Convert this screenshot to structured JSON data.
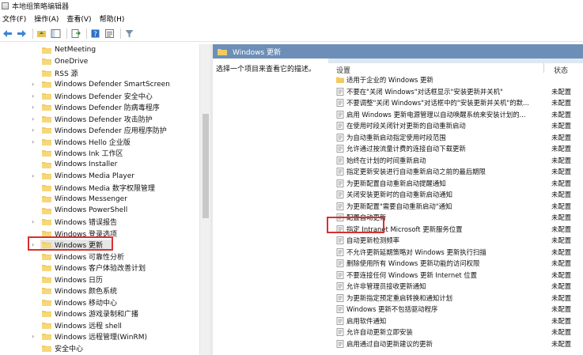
{
  "window": {
    "title": "本地组策略编辑器"
  },
  "menu": [
    "文件(F)",
    "操作(A)",
    "查看(V)",
    "帮助(H)"
  ],
  "toolbar": [
    "back-icon",
    "forward-icon",
    "up-folder-icon",
    "show-hide-tree-icon",
    "export-list-icon",
    "help-icon",
    "properties-icon",
    "filter-icon"
  ],
  "tree": {
    "items": [
      {
        "label": "NetMeeting",
        "expandable": false
      },
      {
        "label": "OneDrive",
        "expandable": false
      },
      {
        "label": "RSS 源",
        "expandable": false
      },
      {
        "label": "Windows Defender SmartScreen",
        "expandable": true
      },
      {
        "label": "Windows Defender 安全中心",
        "expandable": true
      },
      {
        "label": "Windows Defender 防病毒程序",
        "expandable": true
      },
      {
        "label": "Windows Defender 攻击防护",
        "expandable": true
      },
      {
        "label": "Windows Defender 应用程序防护",
        "expandable": true
      },
      {
        "label": "Windows Hello 企业版",
        "expandable": true
      },
      {
        "label": "Windows Ink 工作区",
        "expandable": false
      },
      {
        "label": "Windows Installer",
        "expandable": false
      },
      {
        "label": "Windows Media Player",
        "expandable": true
      },
      {
        "label": "Windows Media 数字权限管理",
        "expandable": false
      },
      {
        "label": "Windows Messenger",
        "expandable": false
      },
      {
        "label": "Windows PowerShell",
        "expandable": false
      },
      {
        "label": "Windows 错误报告",
        "expandable": true
      },
      {
        "label": "Windows 登录选项",
        "expandable": false
      },
      {
        "label": "Windows 更新",
        "expandable": true,
        "selected": true
      },
      {
        "label": "Windows 可靠性分析",
        "expandable": false
      },
      {
        "label": "Windows 客户体验改善计划",
        "expandable": false
      },
      {
        "label": "Windows 日历",
        "expandable": false
      },
      {
        "label": "Windows 颜色系统",
        "expandable": false
      },
      {
        "label": "Windows 移动中心",
        "expandable": false
      },
      {
        "label": "Windows 游戏录制和广播",
        "expandable": false
      },
      {
        "label": "Windows 远程 shell",
        "expandable": false
      },
      {
        "label": "Windows 远程管理(WinRM)",
        "expandable": true
      },
      {
        "label": "安全中心",
        "expandable": false
      }
    ]
  },
  "right": {
    "header": "Windows 更新",
    "description": "选择一个项目来查看它的描述。",
    "columns": {
      "setting": "设置",
      "state": "状态"
    },
    "rows": [
      {
        "name": "适用于企业的 Windows 更新",
        "state": "",
        "folder": true
      },
      {
        "name": "不要在\"关闭 Windows\"对话框显示\"安装更新并关机\"",
        "state": "未配置"
      },
      {
        "name": "不要调整\"关闭 Windows\"对话框中的\"安装更新并关机\"的默...",
        "state": "未配置"
      },
      {
        "name": "启用 Windows 更新电源管理以自动唤醒系统来安装计划的...",
        "state": "未配置"
      },
      {
        "name": "在使用时段关闭针对更新的自动重新启动",
        "state": "未配置"
      },
      {
        "name": "为自动重新启动指定使用时段范围",
        "state": "未配置"
      },
      {
        "name": "允许通过按流量计费的连接自动下载更新",
        "state": "未配置"
      },
      {
        "name": "始终在计划的时间重新启动",
        "state": "未配置"
      },
      {
        "name": "指定更新安装进行自动重新启动之前的最后期限",
        "state": "未配置"
      },
      {
        "name": "为更新配置自动重新启动提醒通知",
        "state": "未配置"
      },
      {
        "name": "关闭安装更新时的自动重新启动通知",
        "state": "未配置"
      },
      {
        "name": "为更新配置\"需要自动重新启动\"通知",
        "state": "未配置"
      },
      {
        "name": "配置自动更新",
        "state": "未配置"
      },
      {
        "name": "指定 Intranet Microsoft 更新服务位置",
        "state": "未配置"
      },
      {
        "name": "自动更新检测频率",
        "state": "未配置"
      },
      {
        "name": "不允许更新延期策略对 Windows 更新执行扫描",
        "state": "未配置"
      },
      {
        "name": "删除使用所有 Windows 更新功能的访问权限",
        "state": "未配置"
      },
      {
        "name": "不要连接任何 Windows 更新 Internet 位置",
        "state": "未配置"
      },
      {
        "name": "允许非管理员接收更新通知",
        "state": "未配置"
      },
      {
        "name": "为更新指定预定重启转换和通知计划",
        "state": "未配置"
      },
      {
        "name": "Windows 更新不包括驱动程序",
        "state": "未配置"
      },
      {
        "name": "启用软件通知",
        "state": "未配置"
      },
      {
        "name": "允许自动更新立即安装",
        "state": "未配置"
      },
      {
        "name": "启用通过自动更新建议的更新",
        "state": "未配置"
      }
    ]
  }
}
